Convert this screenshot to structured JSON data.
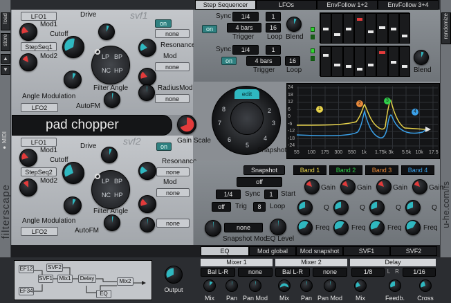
{
  "colors": {
    "teal": "#2fb8c0",
    "red": "#e23b3b",
    "orange": "#e8893a",
    "green": "#2fd04a",
    "yellow": "#e6d24a",
    "blue": "#3aa0e8"
  },
  "left_side": {
    "load": "load",
    "store": "store",
    "midi": "MIDI",
    "brand": "filterscape"
  },
  "right_side": {
    "randomize": "randomize",
    "brand": "u-he.com/fs"
  },
  "tabs_top": [
    "Step Sequencer",
    "LFOs",
    "EnvFollow 1+2",
    "EnvFollow 3+4"
  ],
  "filter1": {
    "name": "svf1",
    "mod1_src": "LFO1",
    "mod1": "Mod1",
    "cutoff": "Cutoff",
    "mod2_src": "StepSeq1",
    "mod2": "Mod2",
    "drive": "Drive",
    "on": "on",
    "drive_src": "none",
    "resonance": "Resonance",
    "mod": "Mod",
    "mod_src": "none",
    "angle_mod": "Angle Modulation",
    "angle_src": "LFO2",
    "filter_angle": "Filter Angle",
    "radius_mod": "RadiusMod",
    "radius_src": "none",
    "autofm": "AutoFM",
    "modes": [
      "LP",
      "BP",
      "NC",
      "HP"
    ]
  },
  "filter2": {
    "name": "svf2",
    "mod1_src": "LFO1",
    "mod1": "Mod1",
    "cutoff": "Cutoff",
    "mod2_src": "StepSeq2",
    "mod2": "Mod2",
    "drive": "Drive",
    "on": "on",
    "resonance": "Resonance",
    "res_src": "none",
    "mod": "Mod",
    "mod_src": "none",
    "angle_mod": "Angle Modulation",
    "angle_src": "LFO2",
    "filter_angle": "Filter Angle",
    "autofm": "AutoFM",
    "modes": [
      "LP",
      "BP",
      "NC",
      "HP"
    ]
  },
  "preset": {
    "name": "pad chopper",
    "gain_scale": "Gain Scale"
  },
  "snapshot_wheel": {
    "edit": "edit",
    "label": "Snapshot",
    "numbers": [
      "1",
      "2",
      "3",
      "4",
      "5",
      "6",
      "7",
      "8"
    ]
  },
  "seq1": {
    "sync_label": "Sync",
    "sync": "1/4",
    "sync_val": "1",
    "on": "on",
    "trigger_val": "4 bars",
    "trigger": "Trigger",
    "loop_val": "16",
    "loop": "Loop",
    "blend": "Blend",
    "steps": [
      0.55,
      0.35,
      0.55,
      0.9,
      0.45,
      0.6,
      0.55,
      0.3
    ]
  },
  "seq2": {
    "sync_label": "Sync",
    "sync": "1/4",
    "sync_val": "1",
    "on": "on",
    "trigger_val": "4 bars",
    "trigger": "Trigger",
    "loop_val": "16",
    "loop": "Loop",
    "blend": "Blend",
    "steps": [
      0.8,
      0.45,
      0.4,
      0.3,
      0.45,
      0.9,
      0.55,
      0.4
    ]
  },
  "eq_graph": {
    "y_ticks": [
      "24",
      "18",
      "12",
      "6",
      "0",
      "-6",
      "-12",
      "-18",
      "-24"
    ],
    "x_ticks": [
      "55",
      "100",
      "175",
      "300",
      "550",
      "1k",
      "1.75k",
      "3k",
      "5.5k",
      "10k",
      "17.5"
    ],
    "nodes": [
      "1",
      "2",
      "3",
      "4"
    ]
  },
  "snapshot_panel": {
    "title": "Snapshot",
    "mode": "off",
    "sync_val": "1/4",
    "sync": "Sync",
    "start_val": "1",
    "start": "Start",
    "trig_val": "off",
    "trig": "Trig",
    "loop_val": "8",
    "loop": "Loop",
    "snap_mod_src": "none",
    "snap_mod": "Snapshot Mod",
    "eq_level": "EQ Level"
  },
  "eq_bands": [
    {
      "name": "Band 1",
      "gain": "Gain",
      "q": "Q",
      "freq": "Freq"
    },
    {
      "name": "Band 2",
      "gain": "Gain",
      "q": "Q",
      "freq": "Freq"
    },
    {
      "name": "Band 3",
      "gain": "Gain",
      "q": "Q",
      "freq": "Freq"
    },
    {
      "name": "Band 4",
      "gain": "Gain",
      "q": "Q",
      "freq": "Freq"
    }
  ],
  "tabs_bottom": [
    "EQ",
    "Mod global",
    "Mod snapshot",
    "SVF1",
    "SVF2"
  ],
  "routing": {
    "ef12": "EF12",
    "ef34": "EF34",
    "svf1": "SVF1",
    "svf2": "SVF2",
    "mix1": "Mix1",
    "delay": "Delay",
    "mix2": "Mix2",
    "eq": "EQ"
  },
  "output": {
    "label": "Output"
  },
  "mixer1": {
    "title": "Mixer 1",
    "bal": "Bal L-R",
    "src": "none",
    "mix": "Mix",
    "pan": "Pan",
    "panmod": "Pan Mod"
  },
  "mixer2": {
    "title": "Mixer 2",
    "bal": "Bal L-R",
    "src": "none",
    "mix": "Mix",
    "pan": "Pan",
    "panmod": "Pan Mod"
  },
  "delay": {
    "title": "Delay",
    "left": "1/8",
    "l": "L",
    "r": "R",
    "right": "1/16",
    "mix": "Mix",
    "feedb": "Feedb.",
    "cross": "Cross"
  }
}
